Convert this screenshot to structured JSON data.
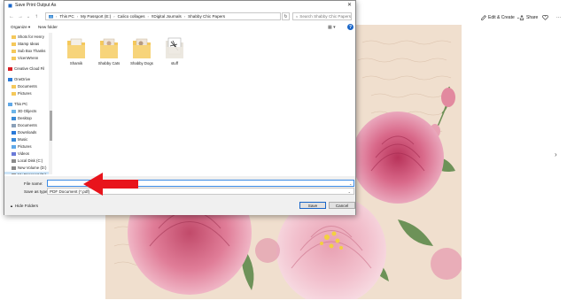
{
  "background_app": {
    "actions": [
      {
        "icon": "edit-icon",
        "label": "Edit & Create",
        "chevron": "⌄"
      },
      {
        "icon": "share-icon",
        "label": "Share"
      },
      {
        "icon": "heart-icon",
        "label": "Favorite"
      },
      {
        "icon": "more-icon",
        "label": "···"
      }
    ],
    "photo_image": "shabby chic pink roses artwork",
    "nav_next": "›"
  },
  "dialog": {
    "title": "Save Print Output As",
    "close_glyph": "✕",
    "nav": {
      "back": "←",
      "forward": "→",
      "recent": "⌄",
      "up": "↑"
    },
    "breadcrumb": [
      "This PC",
      "My Passport (E:)",
      "Calico collages",
      "!!Digital Journals",
      "Shabby Chic Papers"
    ],
    "refresh_glyph": "↻",
    "search_placeholder": "Search Shabby Chic Papers",
    "toolbar": {
      "organize": "Organize ▾",
      "new_folder": "New folder",
      "view": "▦ ▾",
      "help": "?"
    },
    "nav_pane": {
      "items": [
        {
          "label": "Shots for Henry",
          "icon": "folder-icon"
        },
        {
          "label": "Stamp Ideas",
          "icon": "folder-icon"
        },
        {
          "label": "Sub Box Thanks",
          "icon": "folder-icon"
        },
        {
          "label": "VicenWrenn",
          "icon": "folder-icon"
        },
        {
          "label": "Creative Cloud Fil",
          "icon": "creative-cloud-icon"
        },
        {
          "label": "OneDrive",
          "icon": "onedrive-icon"
        },
        {
          "label": "Documents",
          "icon": "folder-icon"
        },
        {
          "label": "Pictures",
          "icon": "folder-icon"
        },
        {
          "label": "This PC",
          "icon": "pc-icon"
        },
        {
          "label": "3D Objects",
          "icon": "3d-objects-icon"
        },
        {
          "label": "Desktop",
          "icon": "desktop-icon"
        },
        {
          "label": "Documents",
          "icon": "documents-icon"
        },
        {
          "label": "Downloads",
          "icon": "downloads-icon"
        },
        {
          "label": "Music",
          "icon": "music-icon"
        },
        {
          "label": "Pictures",
          "icon": "pictures-icon"
        },
        {
          "label": "Videos",
          "icon": "videos-icon"
        },
        {
          "label": "Local Disk (C:)",
          "icon": "disk-icon"
        },
        {
          "label": "New Volume (D:)",
          "icon": "disk-icon"
        },
        {
          "label": "My Passport (E:)",
          "icon": "disk-icon"
        }
      ]
    },
    "files": [
      {
        "label": "Shamik"
      },
      {
        "label": "Shabby Cats"
      },
      {
        "label": "Shabby Dogs"
      },
      {
        "label": "stuff"
      }
    ],
    "filename_label": "File name:",
    "filename_value": "",
    "savetype_label": "Save as type:",
    "savetype_value": "PDF Document (*.pdf)",
    "hide_folders": "Hide Folders",
    "save_button": "Save",
    "cancel_button": "Cancel"
  },
  "colors": {
    "accent": "#1a66c8",
    "selection": "#cce4f7",
    "folder": "#f5c85a",
    "arrow": "#e8141c"
  }
}
